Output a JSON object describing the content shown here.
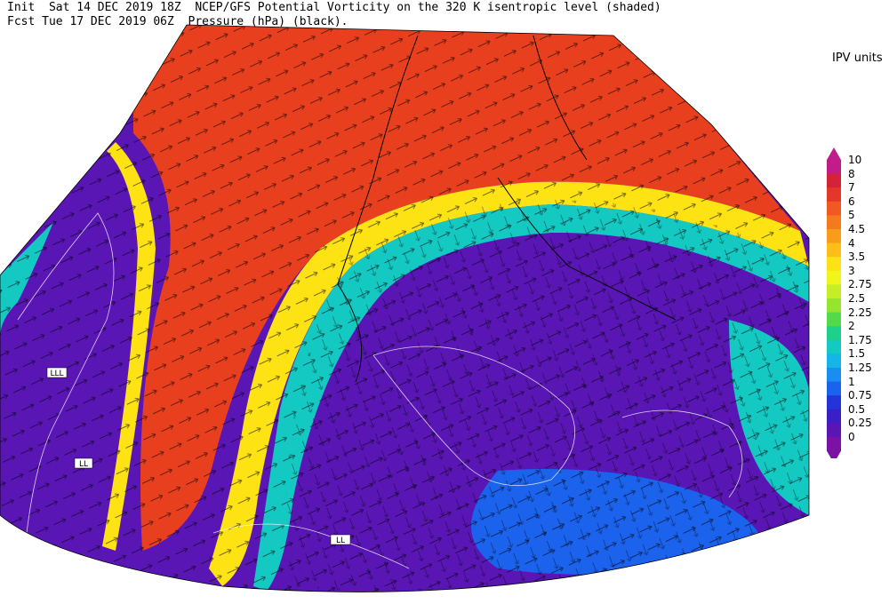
{
  "header": {
    "line1": "Init  Sat 14 DEC 2019 18Z  NCEP/GFS Potential Vorticity on the 320 K isentropic level (shaded)",
    "line2": "Fcst Tue 17 DEC 2019 06Z  Pressure (hPa) (black)."
  },
  "legend": {
    "units_label": "IPV units",
    "levels": [
      "10",
      "8",
      "7",
      "6",
      "5",
      "4.5",
      "4",
      "3.5",
      "3",
      "2.75",
      "2.5",
      "2.25",
      "2",
      "1.75",
      "1.5",
      "1.25",
      "1",
      "0.75",
      "0.5",
      "0.25",
      "0"
    ],
    "colors": [
      "#c21b8a",
      "#d42236",
      "#e5362a",
      "#f05a22",
      "#f47a1e",
      "#f89c1b",
      "#fbbf17",
      "#fde214",
      "#f0f51a",
      "#c6ee26",
      "#96e42e",
      "#55d94c",
      "#1fd08a",
      "#14c9c2",
      "#16b5e8",
      "#1a8ef0",
      "#1b62ec",
      "#2335d8",
      "#3a1fc7",
      "#5a16b5",
      "#7a12a4"
    ],
    "top_arrow_color": "#c21b8a",
    "bottom_arrow_color": "#7a12a4"
  },
  "map": {
    "label_boxes": [
      "LLL",
      "LL",
      "LL"
    ],
    "field_colors": {
      "high": "#e8401f",
      "mid": "#f47a1e",
      "jet": "#fde214",
      "low": "#5a16b5",
      "vlow": "#3a1fc7",
      "cyan": "#14c9c2",
      "blue": "#1b62ec"
    }
  }
}
